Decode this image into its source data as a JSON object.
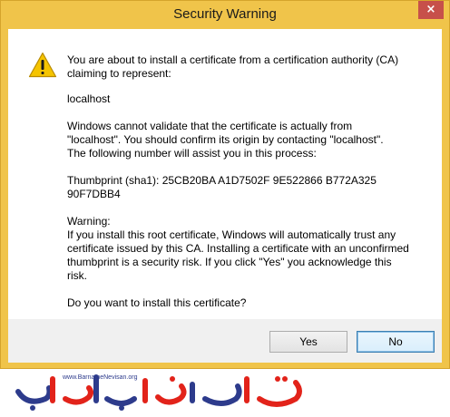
{
  "window": {
    "title": "Security Warning",
    "close_label": "×"
  },
  "message": {
    "intro_line1": "You are about to install a certificate from a certification authority (CA)",
    "intro_line2": "claiming to represent:",
    "host": "localhost",
    "validation_line1": "Windows cannot validate that the certificate is actually from",
    "validation_line2": "\"localhost\". You should confirm its origin by contacting \"localhost\".",
    "validation_line3": "The following number will assist you in this process:",
    "thumbprint": "Thumbprint (sha1): 25CB20BA A1D7502F 9E522866 B772A325 90F7DBB4",
    "warning_heading": "Warning:",
    "warning_line1": "If you install this root certificate, Windows will automatically trust any",
    "warning_line2": "certificate issued by this CA. Installing a certificate with an unconfirmed",
    "warning_line3": "thumbprint is a security risk. If you click \"Yes\" you acknowledge this",
    "warning_line4": "risk.",
    "question": "Do you want to install this certificate?"
  },
  "buttons": {
    "yes": "Yes",
    "no": "No"
  },
  "watermark": {
    "url": "www.BarnameNevisan.org",
    "logo_text": "برنامه نویسان",
    "colors": {
      "red": "#e2231a",
      "blue": "#2d3b8c"
    }
  },
  "colors": {
    "frame": "#f0c44a",
    "close": "#c7504a",
    "button_bar": "#f0f0f0"
  }
}
